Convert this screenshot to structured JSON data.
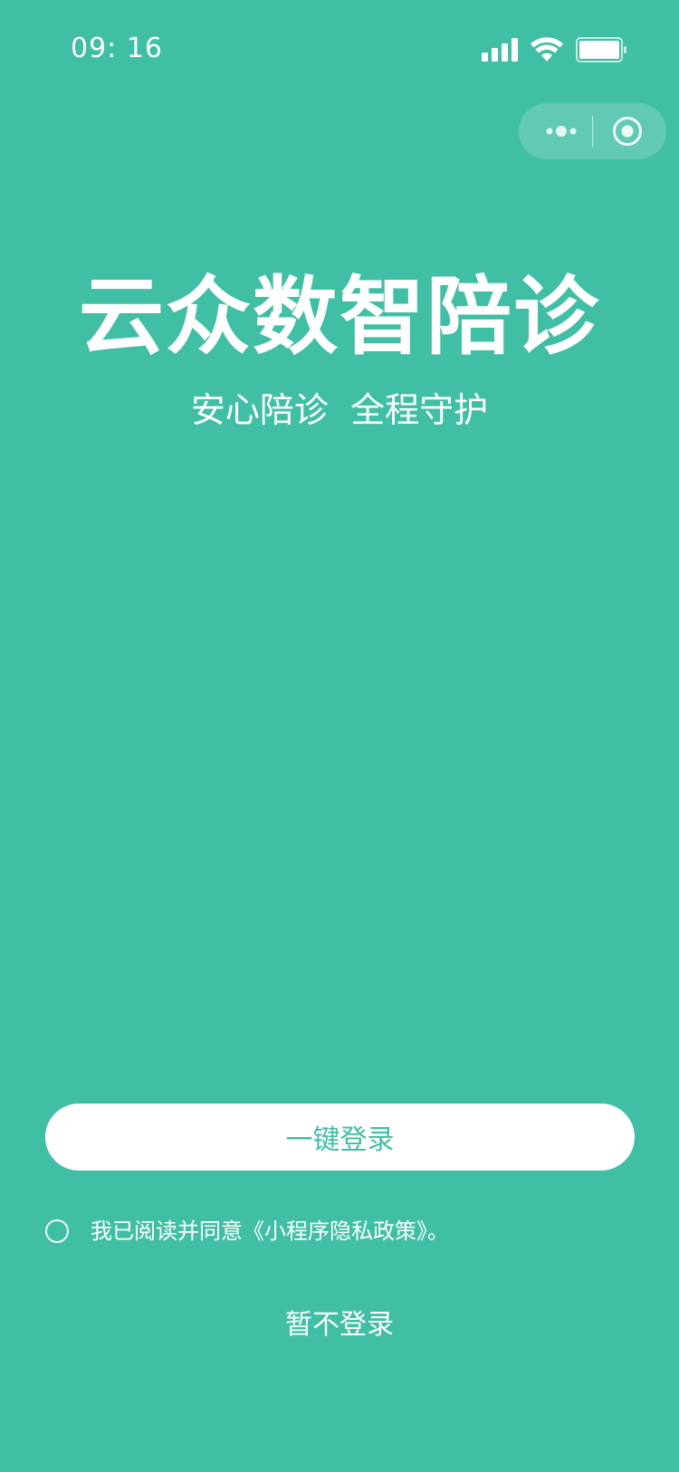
{
  "status_bar": {
    "time": "09: 16",
    "icons": [
      "cellular-signal-icon",
      "wifi-icon",
      "battery-icon"
    ]
  },
  "capsule": {
    "more_icon": "more-dots-icon",
    "close_icon": "circle-target-icon"
  },
  "hero": {
    "title": "云众数智陪诊",
    "subtitle": "安心陪诊  全程守护"
  },
  "login": {
    "button_label": "一键登录"
  },
  "agreement": {
    "prefix": "我已阅读并同意",
    "link": "《小程序隐私政策》",
    "suffix": "。",
    "checked": false
  },
  "skip": {
    "label": "暂不登录"
  },
  "colors": {
    "background": "#40bfa4",
    "button_bg": "#ffffff",
    "button_text": "#40bfa4",
    "text": "#ffffff"
  }
}
